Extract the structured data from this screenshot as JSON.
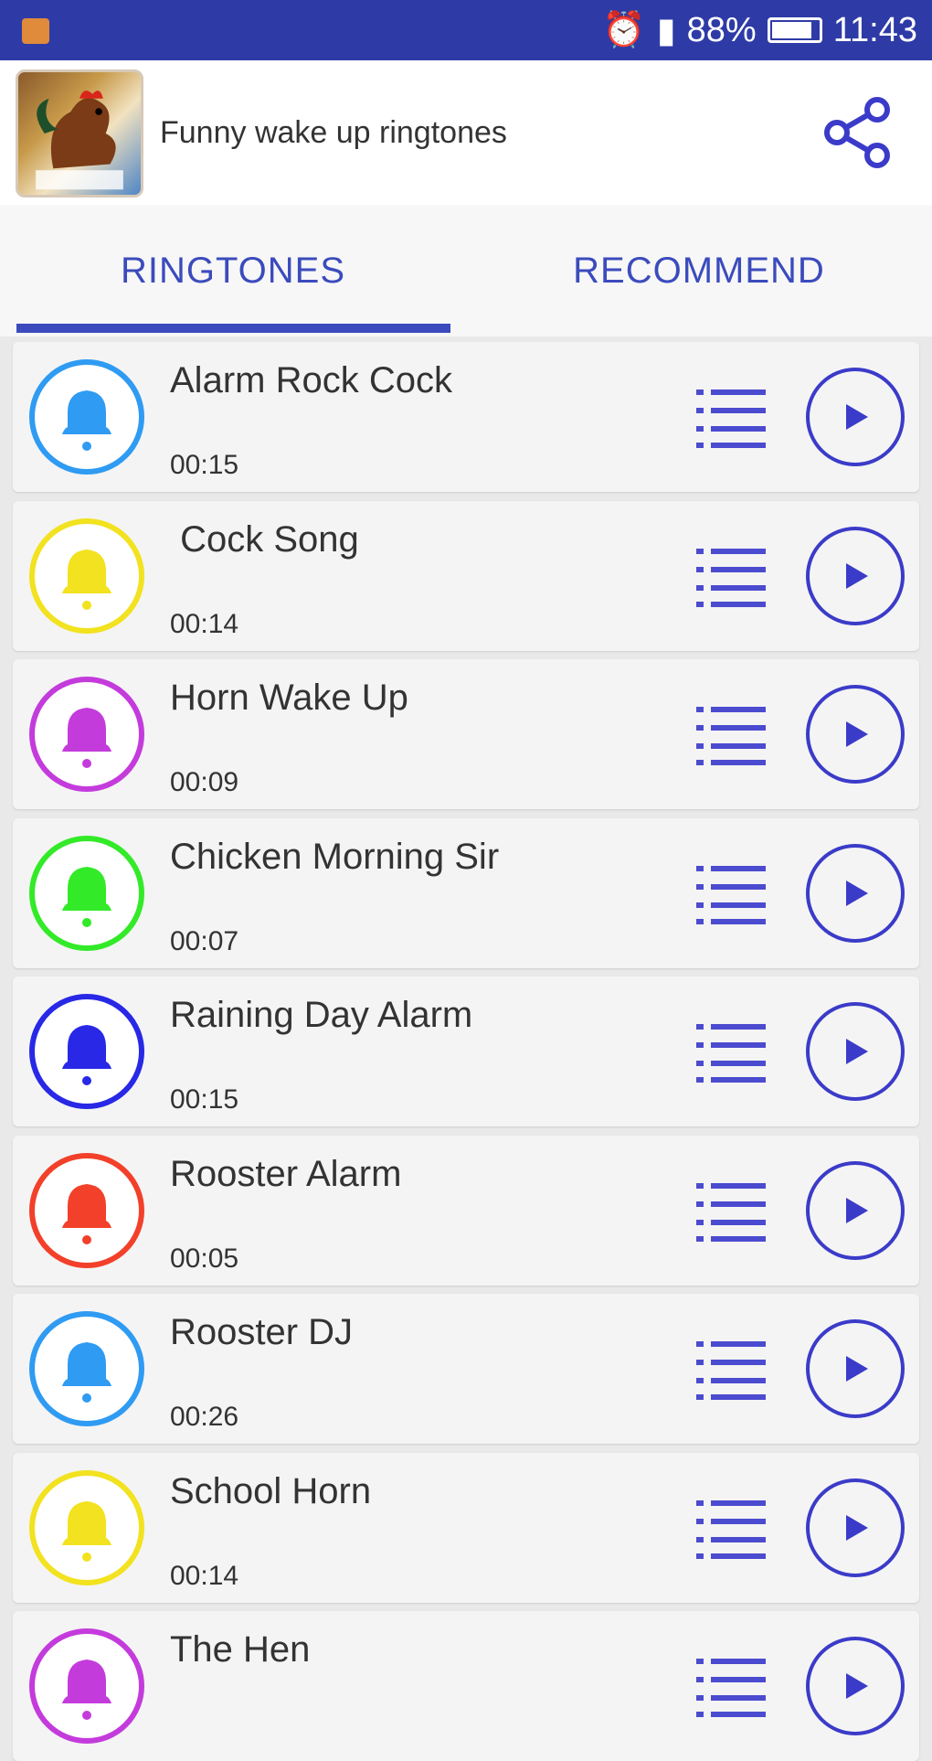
{
  "status_bar": {
    "battery": "88%",
    "time": "11:43"
  },
  "app_bar": {
    "title": "Funny wake up ringtones"
  },
  "tabs": [
    {
      "label": "RINGTONES"
    },
    {
      "label": "RECOMMEND"
    }
  ],
  "accent_color": "#3b4bbd",
  "ringtones": [
    {
      "name": "Alarm Rock Cock",
      "duration": "00:15",
      "color": "#2f9bf2"
    },
    {
      "name": " Cock Song",
      "duration": "00:14",
      "color": "#f2e21f"
    },
    {
      "name": "Horn Wake Up",
      "duration": "00:09",
      "color": "#c43bdc"
    },
    {
      "name": "Chicken Morning Sir",
      "duration": "00:07",
      "color": "#33ea28"
    },
    {
      "name": "Raining Day Alarm",
      "duration": "00:15",
      "color": "#2828e6"
    },
    {
      "name": "Rooster Alarm",
      "duration": "00:05",
      "color": "#f2402a"
    },
    {
      "name": "Rooster DJ",
      "duration": "00:26",
      "color": "#2f9bf2"
    },
    {
      "name": "School Horn",
      "duration": "00:14",
      "color": "#f2e21f"
    },
    {
      "name": "The Hen",
      "duration": "",
      "color": "#c43bdc"
    }
  ]
}
